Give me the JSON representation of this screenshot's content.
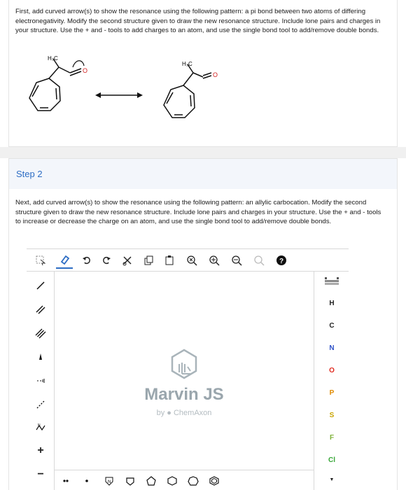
{
  "part1": {
    "instructions": "First, add curved arrow(s) to show the resonance using the following pattern: a pi bond between two atoms of differing electronegativity. Modify the second structure given to draw the new resonance structure. Include lone pairs and charges in your structure. Use the + and - tools to add charges to an atom, and use the single bond tool to add/remove double bonds.",
    "molecule1_group": "H₃C",
    "molecule2_group": "H₃C",
    "oxygen_label": "O"
  },
  "step2": {
    "title": "Step 2",
    "instructions": "Next, add curved arrow(s) to show the resonance using the following pattern: an allylic carbocation. Modify the second structure given to draw the new resonance structure. Include lone pairs and charges in your structure. Use the + and - tools to increase or decrease the charge on an atom, and use the single bond tool to add/remove double bonds."
  },
  "editor": {
    "brand_name": "Marvin JS",
    "brand_by": "by",
    "brand_company": "ChemAxon",
    "elements": [
      "H",
      "C",
      "N",
      "O",
      "P",
      "S",
      "F",
      "Cl"
    ],
    "plus_label": "+",
    "minus_label": "−",
    "help_label": "?"
  },
  "colors": {
    "accent_blue": "#2d6dc4",
    "element_N": "#2f52c8",
    "element_O": "#e02b20",
    "element_P": "#e08a00",
    "element_S": "#c9a400",
    "element_F": "#7fb23a",
    "element_Cl": "#37a637",
    "lone_pair_red": "#d22020"
  }
}
